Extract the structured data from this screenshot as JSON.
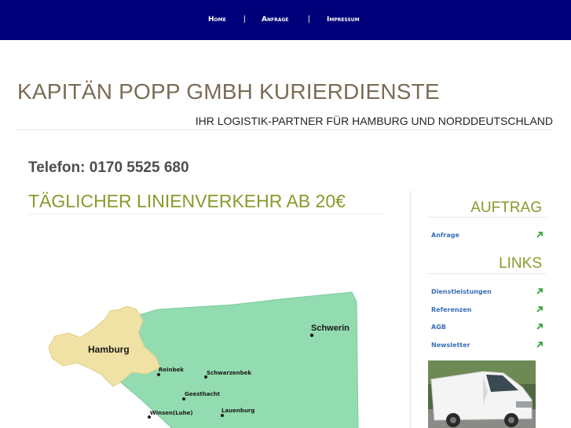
{
  "nav": {
    "items": [
      {
        "label": "Home"
      },
      {
        "label": "Anfrage"
      },
      {
        "label": "Impressum"
      }
    ],
    "separator": "|"
  },
  "header": {
    "title": "KAPITÄN POPP GMBH KURIERDIENSTE",
    "subtitle": "IHR LOGISTIK-PARTNER FÜR HAMBURG UND NORDDEUTSCHLAND"
  },
  "main": {
    "phone": "Telefon: 0170 5525 680",
    "headline": "TÄGLICHER LINIENVERKEHR AB 20€",
    "map": {
      "cities": [
        {
          "name": "Hamburg"
        },
        {
          "name": "Schwerin"
        },
        {
          "name": "Reinbek"
        },
        {
          "name": "Schwarzenbek"
        },
        {
          "name": "Geesthacht"
        },
        {
          "name": "Winsen(Luhe)"
        },
        {
          "name": "Lauenburg"
        }
      ]
    }
  },
  "sidebar": {
    "auftrag_heading": "AUFTRAG",
    "auftrag_links": [
      {
        "label": "Anfrage"
      }
    ],
    "links_heading": "LINKS",
    "links": [
      {
        "label": "Dienstleistungen"
      },
      {
        "label": "Referenzen"
      },
      {
        "label": "AGB"
      },
      {
        "label": "Newsletter"
      }
    ]
  },
  "colors": {
    "nav_bg": "#00007a",
    "title": "#7a6c55",
    "accent_green": "#8a9a2a",
    "link_blue": "#3a6fb8",
    "arrow_green": "#3aa035",
    "map_region_green": "#93dbb0",
    "map_hamburg": "#f0e2a4"
  },
  "icons": {
    "link_arrow": "arrow-up-right-icon"
  }
}
